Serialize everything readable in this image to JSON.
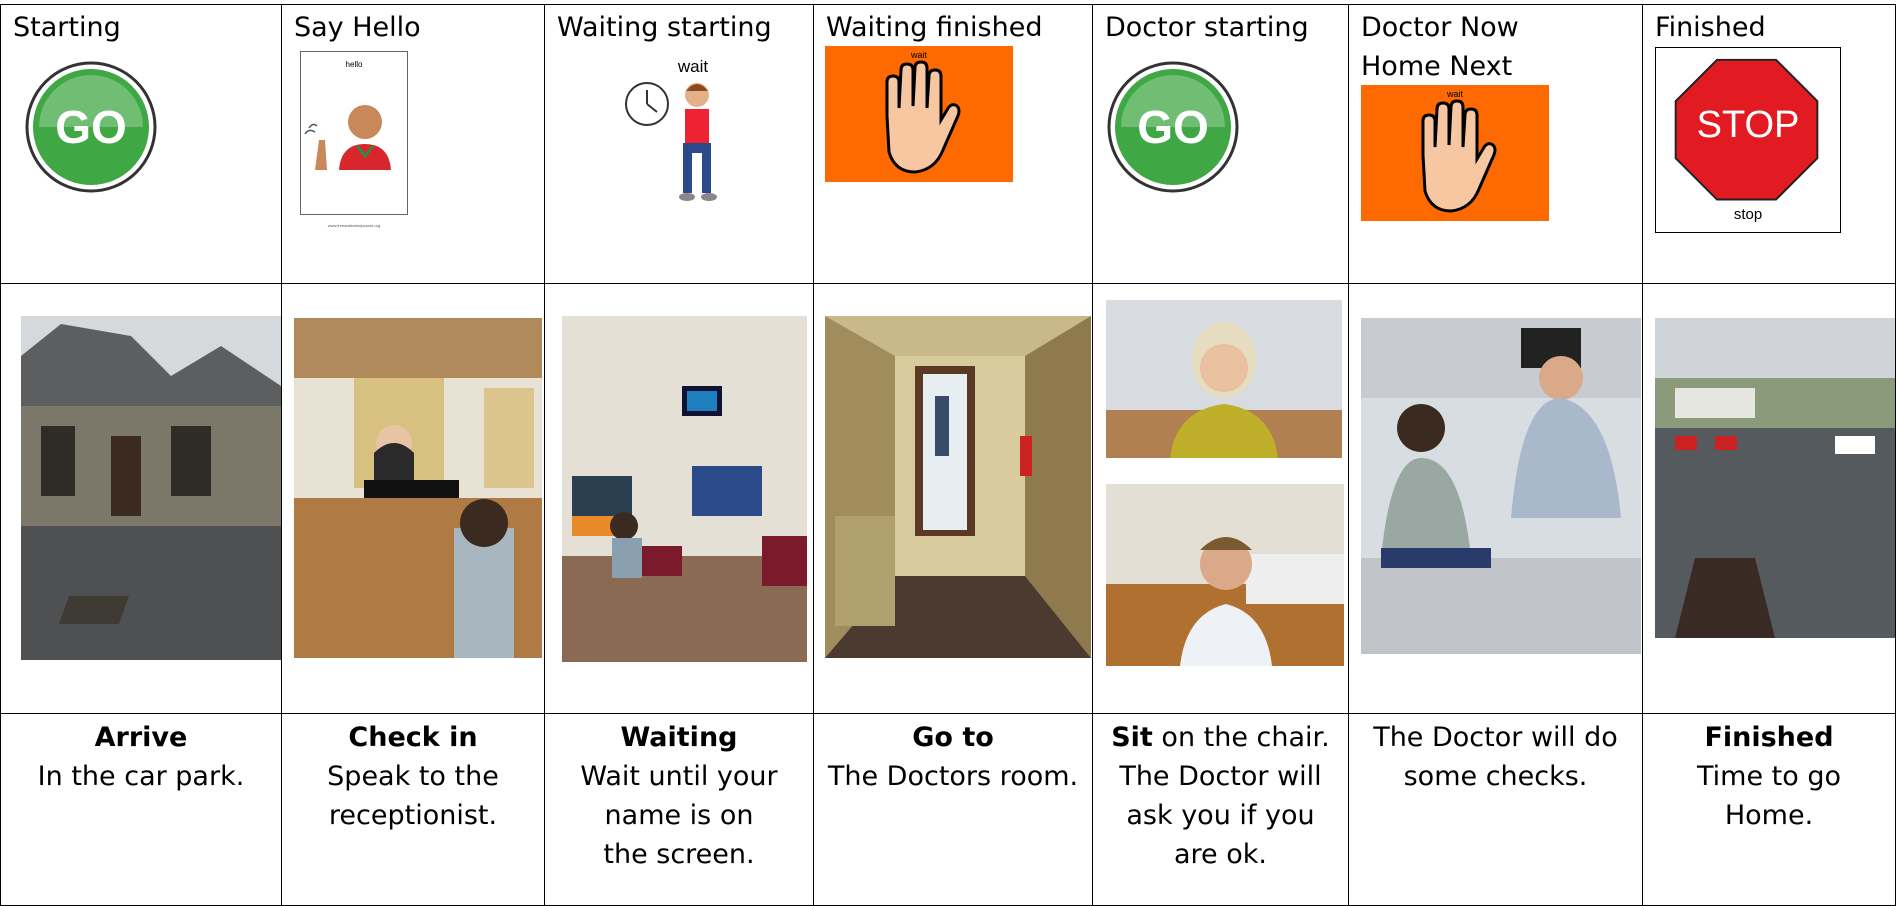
{
  "columns": [
    {
      "header": "Starting",
      "symbol": "go-icon",
      "title": "Arrive",
      "text": "In the car park.",
      "photo": "car-park-photo"
    },
    {
      "header": "Say Hello",
      "symbol": "hello-card-icon",
      "symbol_caption": "hello",
      "symbol_footer": "www.freeautismhelpcards.org",
      "title": "Check in",
      "text": "Speak to the receptionist.",
      "photo": "reception-photo"
    },
    {
      "header": "Waiting starting",
      "symbol": "wait-clock-icon",
      "symbol_caption": "wait",
      "title": "Waiting",
      "text": "Wait until your name is on the screen.",
      "photo": "waiting-room-photo"
    },
    {
      "header": "Waiting finished",
      "symbol": "wait-hand-icon",
      "symbol_caption": "wait",
      "title": "Go to",
      "text": "The Doctors room.",
      "photo": "corridor-photo"
    },
    {
      "header": "Doctor starting",
      "symbol": "go-icon",
      "title": "Sit",
      "text": " on the chair. The Doctor will ask you if you are ok.",
      "photo": "doctors-photo"
    },
    {
      "header": "Doctor Now\nHome Next",
      "symbol": "wait-hand-icon",
      "symbol_caption": "wait",
      "title": "",
      "text": "The Doctor will do some checks.",
      "photo": "checkup-photo"
    },
    {
      "header": "Finished",
      "symbol": "stop-sign-icon",
      "symbol_caption": "STOP",
      "symbol_footer": "stop",
      "title": "Finished",
      "text": "Time to go Home.",
      "photo": "exit-car-park-photo"
    }
  ],
  "symbols": {
    "go_text": "GO"
  },
  "colors": {
    "go_green": "#3fa845",
    "wait_orange": "#ff6a00",
    "stop_red": "#e21b23",
    "hand_skin": "#f7c7a1"
  }
}
